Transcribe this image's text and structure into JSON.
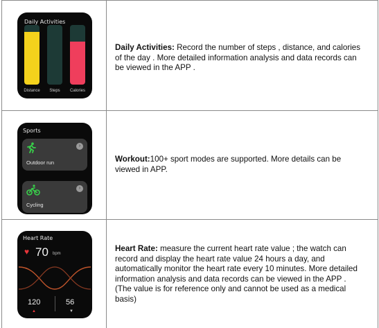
{
  "rows": [
    {
      "watch": {
        "title": "Daily Activities",
        "bars": [
          {
            "label": "Distance",
            "fill_fraction": 0.88,
            "color": "#f4d21c"
          },
          {
            "label": "Steps",
            "fill_fraction": 0.0,
            "color": "#1d3a36"
          },
          {
            "label": "Calories",
            "fill_fraction": 0.72,
            "color": "#ef3e5c"
          }
        ]
      },
      "heading": "Daily Activities:",
      "text": " Record the number of steps , distance, and calories of the day . More detailed information analysis and data records can be viewed in the APP ."
    },
    {
      "watch": {
        "title": "Sports",
        "cards": [
          {
            "label": "Outdoor run",
            "icon": "running-icon"
          },
          {
            "label": "Cycling",
            "icon": "cycling-icon"
          }
        ]
      },
      "heading": "Workout:",
      "text": "100+ sport modes are supported. More details can be viewed in APP."
    },
    {
      "watch": {
        "title": "Heart Rate",
        "value": "70",
        "unit": "bpm",
        "max": "120",
        "min": "56"
      },
      "heading": "Heart Rate:",
      "text": " measure the current heart rate value ; the watch can record and display the heart rate value 24 hours a day, and automatically monitor the heart rate every 10 minutes. More detailed information analysis and data records can be viewed in the APP . (The value is for reference only and cannot be used as a medical basis)"
    }
  ],
  "colors": {
    "accent_green": "#38d04a",
    "heart_red": "#e8353a",
    "curve_orange": "#c2552b"
  }
}
